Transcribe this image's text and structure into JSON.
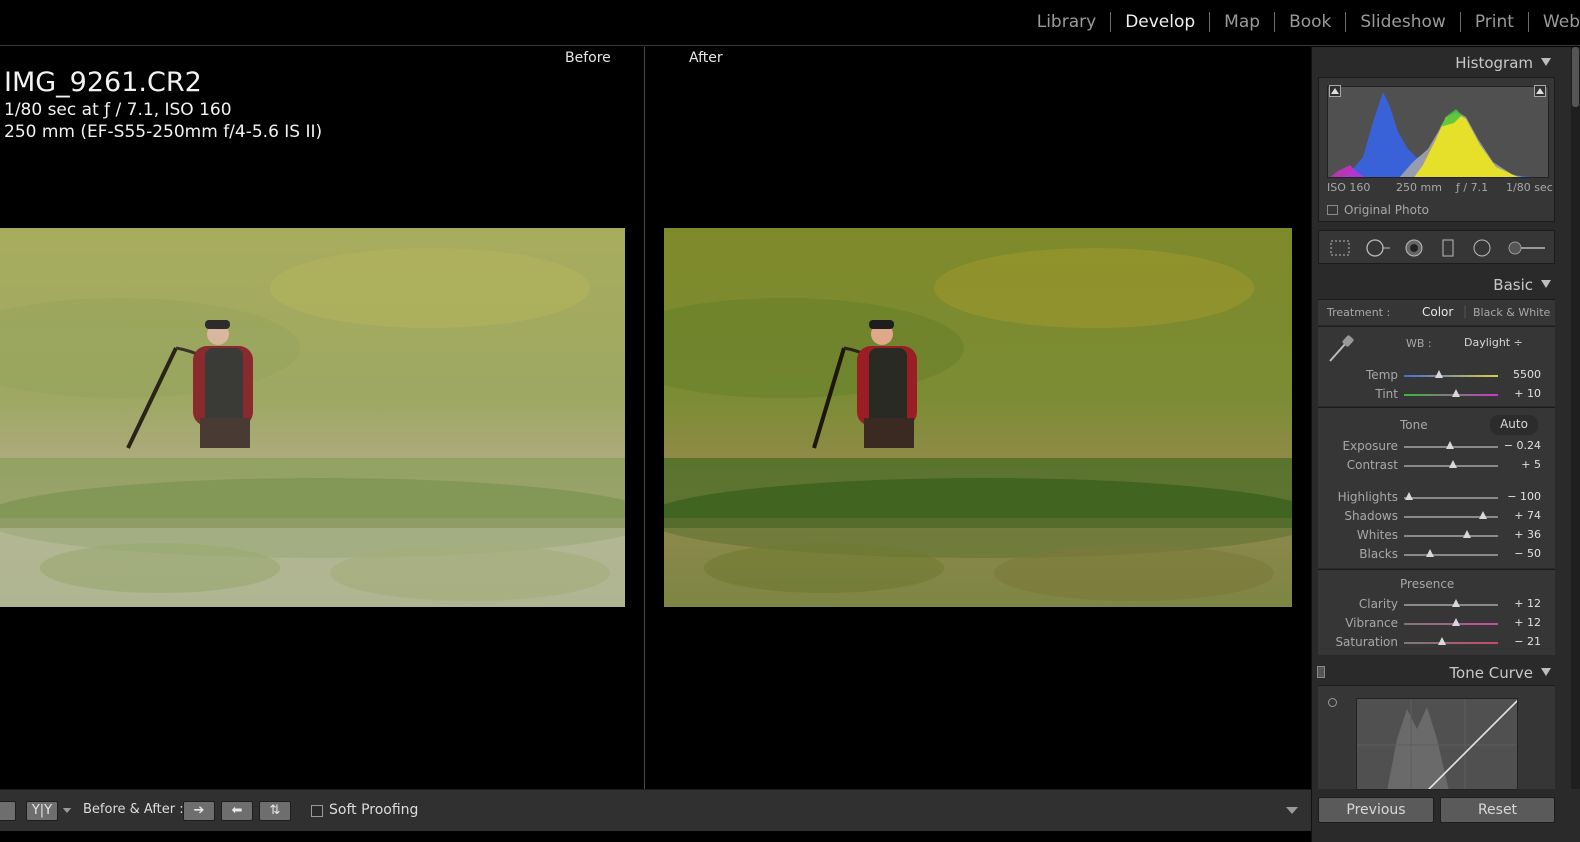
{
  "modules": [
    "Library",
    "Develop",
    "Map",
    "Book",
    "Slideshow",
    "Print",
    "Web"
  ],
  "active_module": "Develop",
  "view": {
    "before_label": "Before",
    "after_label": "After"
  },
  "photo_info": {
    "filename": "IMG_9261.CR2",
    "exposure": "1/80 sec at ƒ / 7.1, ISO 160",
    "lens": "250 mm (EF-S55-250mm f/4-5.6 IS II)"
  },
  "toolbar": {
    "yy_label": "Y|Y",
    "before_after_label": "Before & After :",
    "soft_proofing_label": "Soft Proofing"
  },
  "panels": {
    "histogram": {
      "title": "Histogram",
      "iso": "ISO 160",
      "focal": "250 mm",
      "aperture": "ƒ / 7.1",
      "shutter": "1/80 sec",
      "original_photo_label": "Original Photo"
    },
    "basic": {
      "title": "Basic",
      "treatment_label": "Treatment :",
      "treatment_color": "Color",
      "treatment_bw": "Black & White",
      "wb_label": "WB :",
      "wb_value": "Daylight ÷",
      "tone_label": "Tone",
      "auto_label": "Auto",
      "presence_label": "Presence",
      "sliders": {
        "temp": {
          "name": "Temp",
          "value": "5500",
          "pos": 0.37
        },
        "tint": {
          "name": "Tint",
          "value": "+ 10",
          "pos": 0.55
        },
        "exposure": {
          "name": "Exposure",
          "value": "− 0.24",
          "pos": 0.49
        },
        "contrast": {
          "name": "Contrast",
          "value": "+ 5",
          "pos": 0.52
        },
        "highlights": {
          "name": "Highlights",
          "value": "− 100",
          "pos": 0.05
        },
        "shadows": {
          "name": "Shadows",
          "value": "+ 74",
          "pos": 0.84
        },
        "whites": {
          "name": "Whites",
          "value": "+ 36",
          "pos": 0.67
        },
        "blacks": {
          "name": "Blacks",
          "value": "− 50",
          "pos": 0.28
        },
        "clarity": {
          "name": "Clarity",
          "value": "+ 12",
          "pos": 0.55
        },
        "vibrance": {
          "name": "Vibrance",
          "value": "+ 12",
          "pos": 0.55
        },
        "saturation": {
          "name": "Saturation",
          "value": "− 21",
          "pos": 0.4
        }
      }
    },
    "tone_curve": {
      "title": "Tone Curve"
    }
  },
  "buttons": {
    "previous": "Previous",
    "reset": "Reset"
  },
  "colors": {
    "panel_bg": "#2a2a2a",
    "section_bg": "#363636",
    "active_text": "#f0f0f0"
  }
}
